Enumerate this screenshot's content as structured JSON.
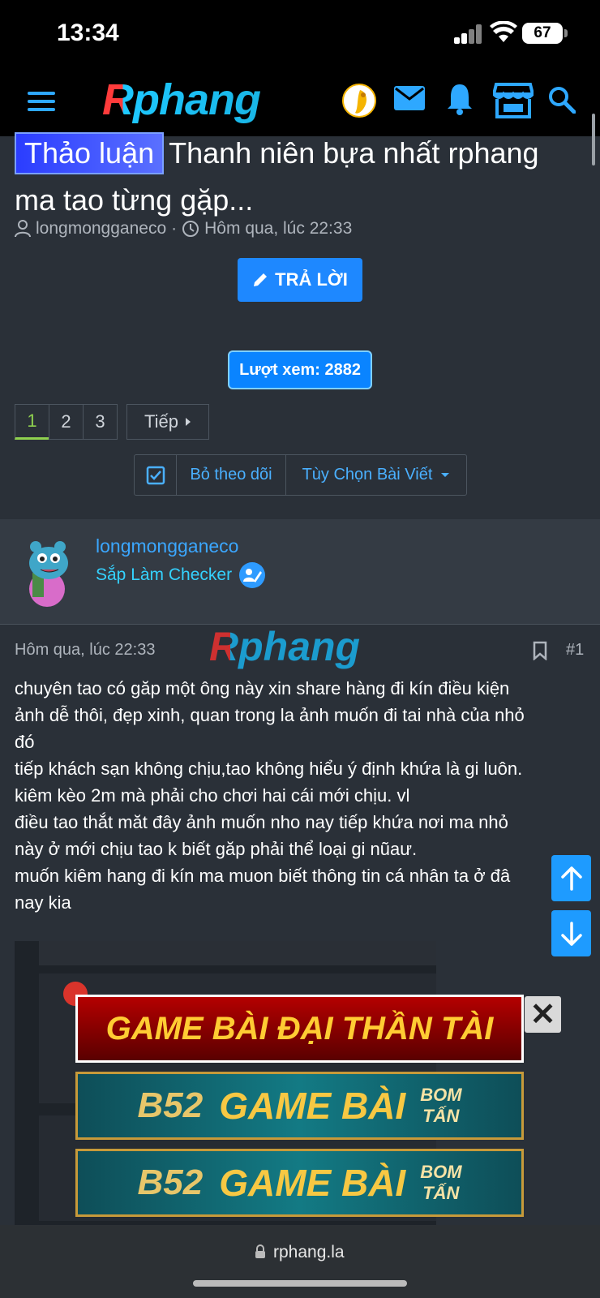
{
  "status": {
    "time": "13:34",
    "battery": "67"
  },
  "header": {
    "logo": "Rphang"
  },
  "thread": {
    "prefix": "Thảo luận",
    "title": "Thanh niên bựa nhất rphang ma tao từng gặp...",
    "author": "longmongganeco",
    "date": "Hôm qua, lúc 22:33",
    "reply_label": "TRẢ LỜI",
    "views": "Lượt xem: 2882"
  },
  "pager": {
    "pages": [
      "1",
      "2",
      "3"
    ],
    "next": "Tiếp"
  },
  "tools": {
    "unwatch": "Bỏ theo dõi",
    "options": "Tùy Chọn Bài Viết"
  },
  "post": {
    "username": "longmongganeco",
    "user_title": "Sắp Làm Checker",
    "date": "Hôm qua, lúc 22:33",
    "watermark": "Rphang",
    "number": "#1",
    "lines": [
      "chuyên tao có găp một ông này xin share hàng đi kín điều kiện",
      "ảnh dễ thôi, đẹp xinh, quan trong la ảnh muốn đi tai nhà của nhỏ",
      "đó",
      "tiếp khách sạn không chịu,tao không hiểu ý định khứa là gi luôn.",
      "kiêm kèo 2m mà phải cho chơi hai cái mới chịu. vl",
      "điều tao thắt măt đây ảnh muốn nho nay tiếp khứa nơi ma nhỏ",
      "này ở mới chịu tao k biết găp phải thể loại gi nũaư.",
      "muốn kiêm hang đi kín ma muon biết thông tin cá nhân ta ở đâ",
      "nay kia"
    ]
  },
  "ads": {
    "ad1": "GAME BÀI ĐẠI THẦN TÀI",
    "b52": "B52",
    "game_bai": "GAME BÀI",
    "bom": "BOM",
    "tan": "TẤN"
  },
  "browser": {
    "url": "rphang.la"
  }
}
